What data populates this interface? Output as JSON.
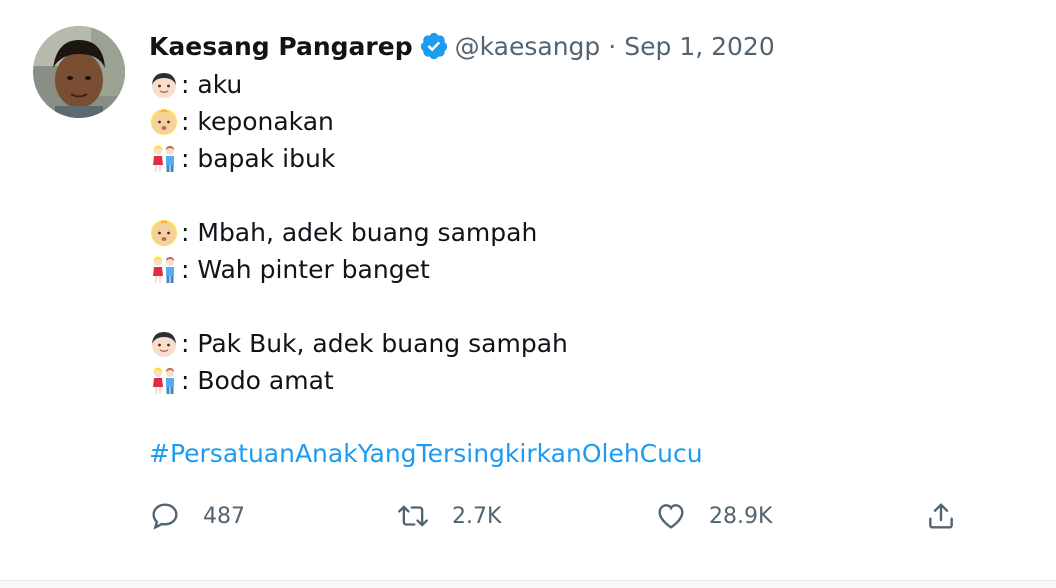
{
  "tweet": {
    "author_name": "Kaesang Pangarep",
    "handle": "@kaesangp",
    "separator": "·",
    "date": "Sep 1, 2020",
    "lines": [
      {
        "emoji": "boy",
        "text": ": aku"
      },
      {
        "emoji": "baby",
        "text": ": keponakan"
      },
      {
        "emoji": "couple",
        "text": ": bapak ibuk"
      },
      {
        "emoji": "baby",
        "text": ": Mbah, adek buang sampah"
      },
      {
        "emoji": "couple",
        "text": ": Wah pinter banget"
      },
      {
        "emoji": "boy",
        "text": ": Pak Buk, adek buang sampah"
      },
      {
        "emoji": "couple",
        "text": ": Bodo amat"
      }
    ],
    "hashtag": "#PersatuanAnakYangTersingkirkanOlehCucu",
    "colors": {
      "link": "#1d9bf0",
      "verified": "#1d9bf0",
      "muted": "#536471"
    }
  },
  "actions": {
    "reply_count": "487",
    "retweet_count": "2.7K",
    "like_count": "28.9K"
  }
}
